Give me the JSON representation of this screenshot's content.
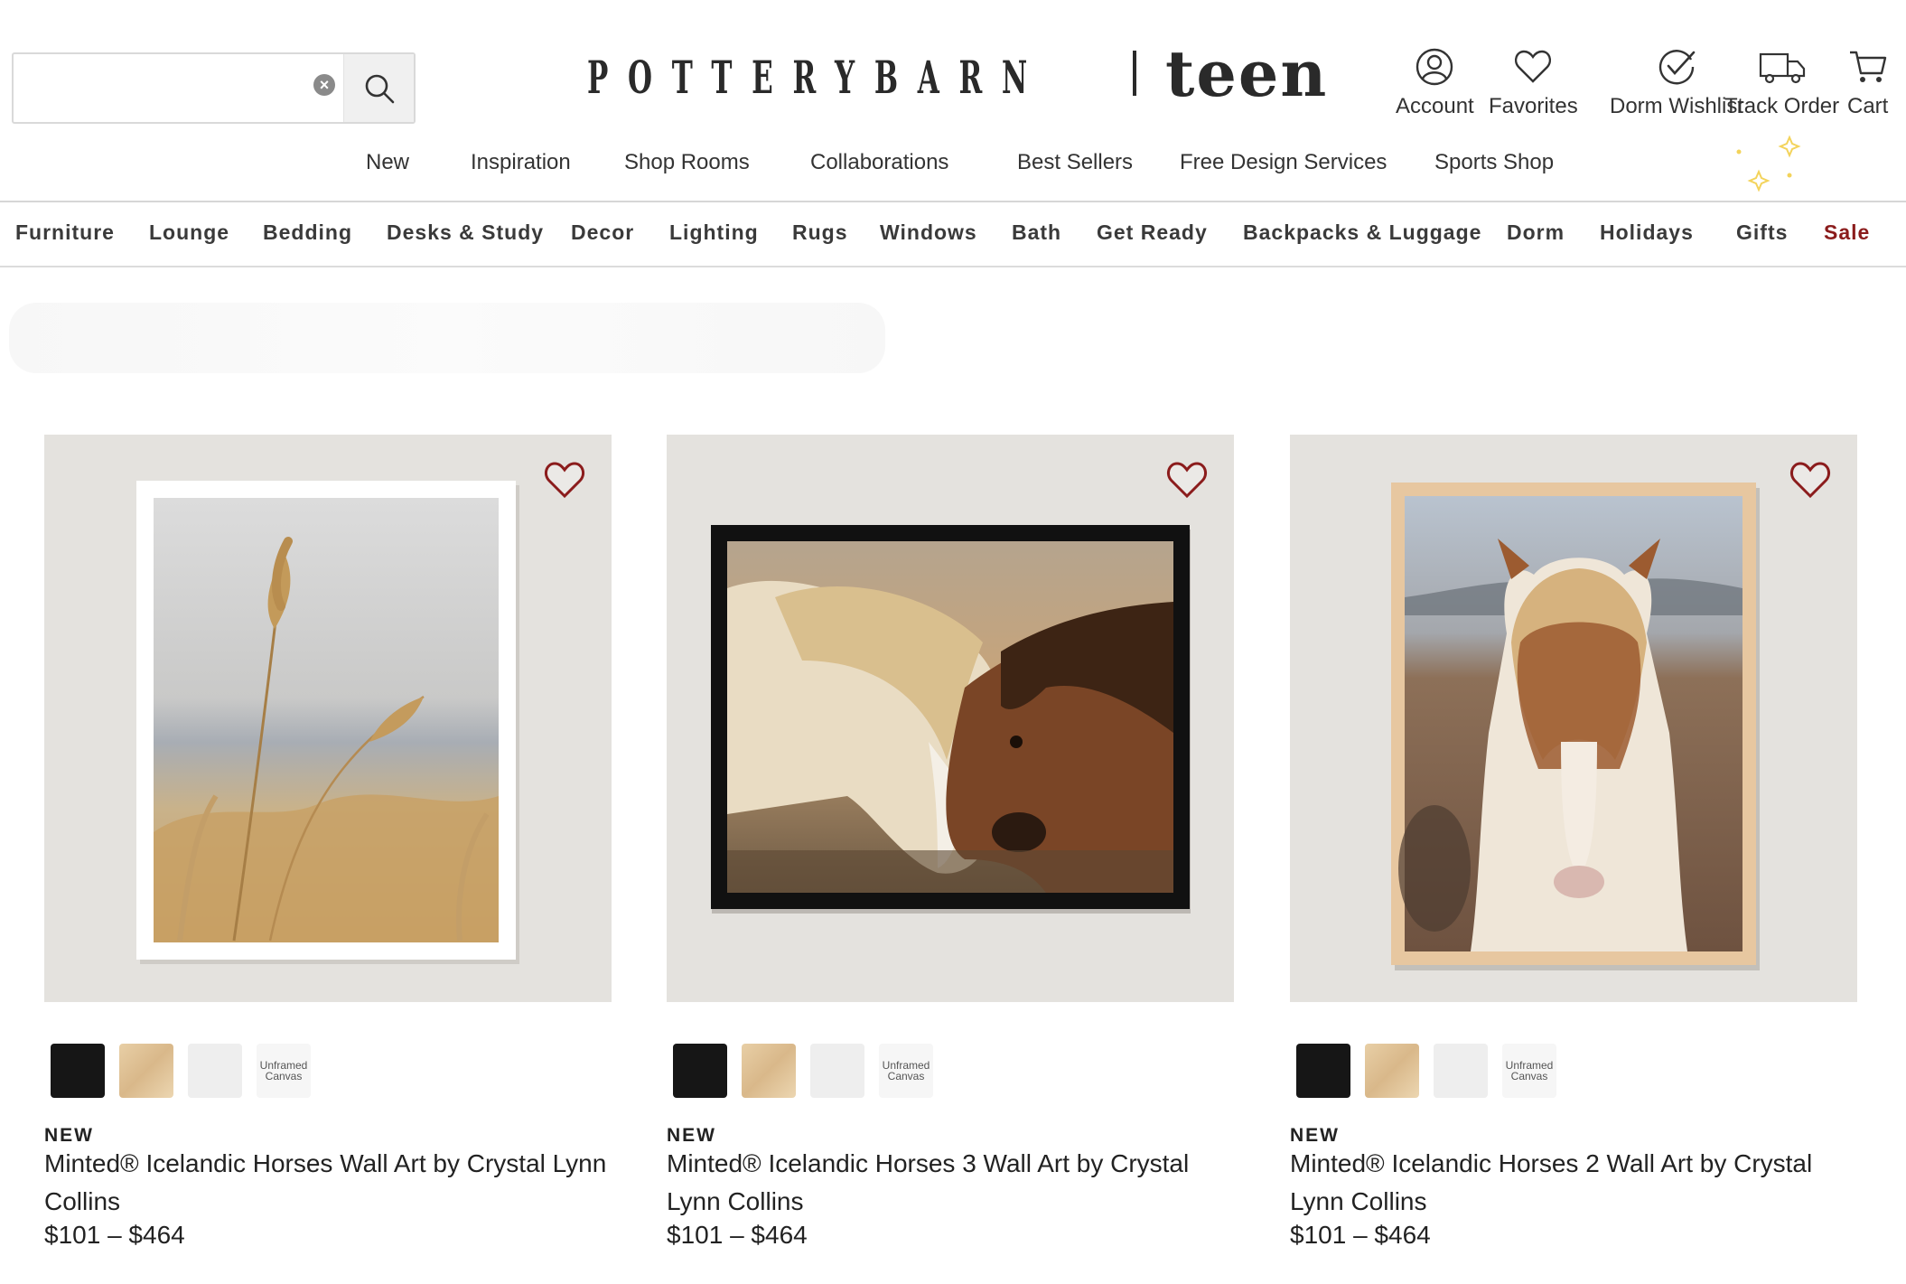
{
  "search": {
    "value": "",
    "placeholder": ""
  },
  "brand": {
    "name": "POTTERYBARN",
    "sub": "teen"
  },
  "utility": [
    {
      "label": "Account",
      "icon": "user-circle-icon"
    },
    {
      "label": "Favorites",
      "icon": "heart-icon"
    },
    {
      "label": "Dorm Wishlist",
      "icon": "check-circle-icon"
    },
    {
      "label": "Track Order",
      "icon": "truck-icon"
    },
    {
      "label": "Cart",
      "icon": "cart-icon"
    }
  ],
  "main_nav": [
    "New",
    "Inspiration",
    "Shop Rooms",
    "Collaborations",
    "Best Sellers",
    "Free Design Services",
    "Sports Shop"
  ],
  "categories": [
    "Furniture",
    "Lounge",
    "Bedding",
    "Desks & Study",
    "Decor",
    "Lighting",
    "Rugs",
    "Windows",
    "Bath",
    "Get Ready",
    "Backpacks & Luggage",
    "Dorm",
    "Holidays",
    "Gifts",
    "Sale"
  ],
  "colors": {
    "sale": "#8b1c1c",
    "heart": "#8b1c1c",
    "sparkle": "#f3d35a"
  },
  "products": [
    {
      "badge": "NEW",
      "title": "Minted® Icelandic Horses Wall Art by Crystal Lynn Collins",
      "price": "$101 – $464",
      "swatches": [
        "black",
        "natural wood",
        "white",
        "Unframed Canvas"
      ],
      "frame": "white"
    },
    {
      "badge": "NEW",
      "title": "Minted® Icelandic Horses 3 Wall Art by Crystal Lynn Collins",
      "price": "$101 – $464",
      "swatches": [
        "black",
        "natural wood",
        "white",
        "Unframed Canvas"
      ],
      "frame": "black"
    },
    {
      "badge": "NEW",
      "title": "Minted® Icelandic Horses 2 Wall Art by Crystal Lynn Collins",
      "price": "$101 – $464",
      "swatches": [
        "black",
        "natural wood",
        "white",
        "Unframed Canvas"
      ],
      "frame": "natural wood"
    }
  ]
}
